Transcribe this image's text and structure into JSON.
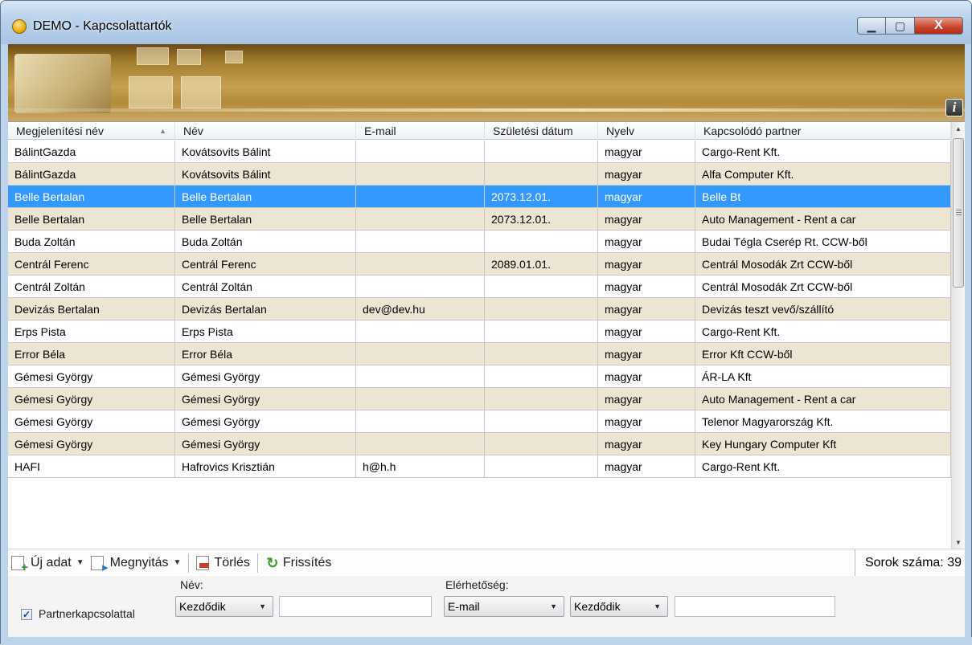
{
  "window": {
    "title": "DEMO - Kapcsolattartók",
    "min_icon": "minimize-icon",
    "max_icon": "maximize-icon",
    "close_icon": "close-icon",
    "min_glyph": "▁",
    "max_glyph": "▢",
    "close_glyph": "X"
  },
  "banner": {
    "info_glyph": "i"
  },
  "grid": {
    "columns": [
      "Megjelenítési név",
      "Név",
      "E-mail",
      "Születési dátum",
      "Nyelv",
      "Kapcsolódó partner"
    ],
    "sort_glyph": "▲",
    "rows": [
      [
        "BálintGazda",
        "Kovátsovits Bálint",
        "",
        "",
        "magyar",
        "Cargo-Rent Kft."
      ],
      [
        "BálintGazda",
        "Kovátsovits Bálint",
        "",
        "",
        "magyar",
        "Alfa Computer Kft."
      ],
      [
        "Belle Bertalan",
        "Belle Bertalan",
        "",
        "2073.12.01.",
        "magyar",
        "Belle Bt"
      ],
      [
        "Belle Bertalan",
        "Belle Bertalan",
        "",
        "2073.12.01.",
        "magyar",
        "Auto Management - Rent a car"
      ],
      [
        "Buda Zoltán",
        "Buda Zoltán",
        "",
        "",
        "magyar",
        "Budai Tégla Cserép Rt. CCW-ből"
      ],
      [
        "Centrál Ferenc",
        "Centrál Ferenc",
        "",
        "2089.01.01.",
        "magyar",
        "Centrál Mosodák Zrt CCW-ből"
      ],
      [
        "Centrál Zoltán",
        "Centrál Zoltán",
        "",
        "",
        "magyar",
        "Centrál Mosodák Zrt CCW-ből"
      ],
      [
        "Devizás Bertalan",
        "Devizás Bertalan",
        "dev@dev.hu",
        "",
        "magyar",
        "Devizás teszt vevő/szállító"
      ],
      [
        "Erps Pista",
        "Erps Pista",
        "",
        "",
        "magyar",
        "Cargo-Rent Kft."
      ],
      [
        "Error Béla",
        "Error Béla",
        "",
        "",
        "magyar",
        "Error Kft CCW-ből"
      ],
      [
        "Gémesi György",
        "Gémesi György",
        "",
        "",
        "magyar",
        "ÁR-LA Kft"
      ],
      [
        "Gémesi György",
        "Gémesi György",
        "",
        "",
        "magyar",
        "Auto Management - Rent a car"
      ],
      [
        "Gémesi György",
        "Gémesi György",
        "",
        "",
        "magyar",
        "Telenor Magyarország Kft."
      ],
      [
        "Gémesi György",
        "Gémesi György",
        "",
        "",
        "magyar",
        "Key Hungary Computer Kft"
      ],
      [
        "HAFI",
        "Hafrovics Krisztián",
        "h@h.h",
        "",
        "magyar",
        "Cargo-Rent Kft."
      ]
    ],
    "selected_row": 2
  },
  "toolbar": {
    "new_label": "Új adat",
    "open_label": "Megnyitás",
    "delete_label": "Törlés",
    "refresh_label": "Frissítés",
    "refresh_glyph": "↻",
    "dropdown_glyph": "▼",
    "row_count_label": "Sorok száma:",
    "row_count": "39"
  },
  "filter": {
    "partner_checkbox_label": "Partnerkapcsolattal",
    "partner_checked": true,
    "check_glyph": "✓",
    "name_label": "Név:",
    "name_mode": "Kezdődik",
    "name_value": "",
    "contact_label": "Elérhetőség:",
    "contact_type": "E-mail",
    "contact_mode": "Kezdődik",
    "contact_value": ""
  },
  "colors": {
    "selection": "#3399ff",
    "alt_row": "#ede5d4",
    "banner": "#b28a3a"
  }
}
